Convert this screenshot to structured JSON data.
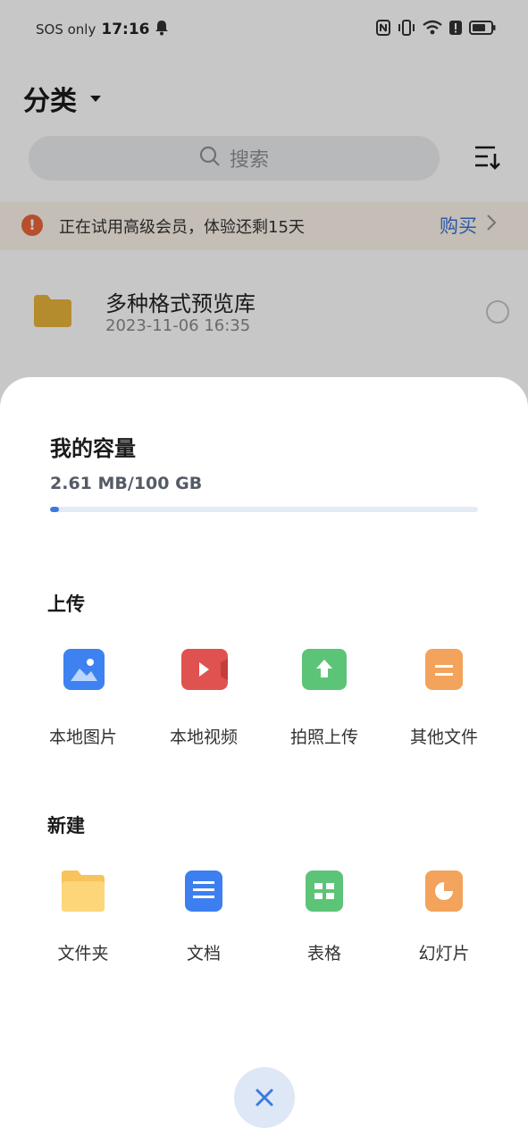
{
  "status_bar": {
    "carrier": "SOS only",
    "time": "17:16"
  },
  "header": {
    "title": "分类"
  },
  "search": {
    "placeholder": "搜索"
  },
  "banner": {
    "message": "正在试用高级会员，体验还剩15天",
    "action": "购买"
  },
  "file_list": [
    {
      "name": "多种格式预览库",
      "date": "2023-11-06 16:35"
    }
  ],
  "sheet": {
    "capacity_title": "我的容量",
    "capacity_value": "2.61 MB/100 GB",
    "capacity_used_fraction": 0.02,
    "upload_title": "上传",
    "upload_items": [
      {
        "label": "本地图片",
        "icon": "image-icon",
        "color": "#3d82f0"
      },
      {
        "label": "本地视频",
        "icon": "video-icon",
        "color": "#e0524f"
      },
      {
        "label": "拍照上传",
        "icon": "camera-upload-icon",
        "color": "#5cc476"
      },
      {
        "label": "其他文件",
        "icon": "file-icon",
        "color": "#f3a35b"
      }
    ],
    "create_title": "新建",
    "create_items": [
      {
        "label": "文件夹",
        "icon": "folder-icon",
        "color": "#f7c35a"
      },
      {
        "label": "文档",
        "icon": "document-icon",
        "color": "#3d7ff0"
      },
      {
        "label": "表格",
        "icon": "spreadsheet-icon",
        "color": "#5cc476"
      },
      {
        "label": "幻灯片",
        "icon": "slides-icon",
        "color": "#f3a35b"
      }
    ]
  }
}
